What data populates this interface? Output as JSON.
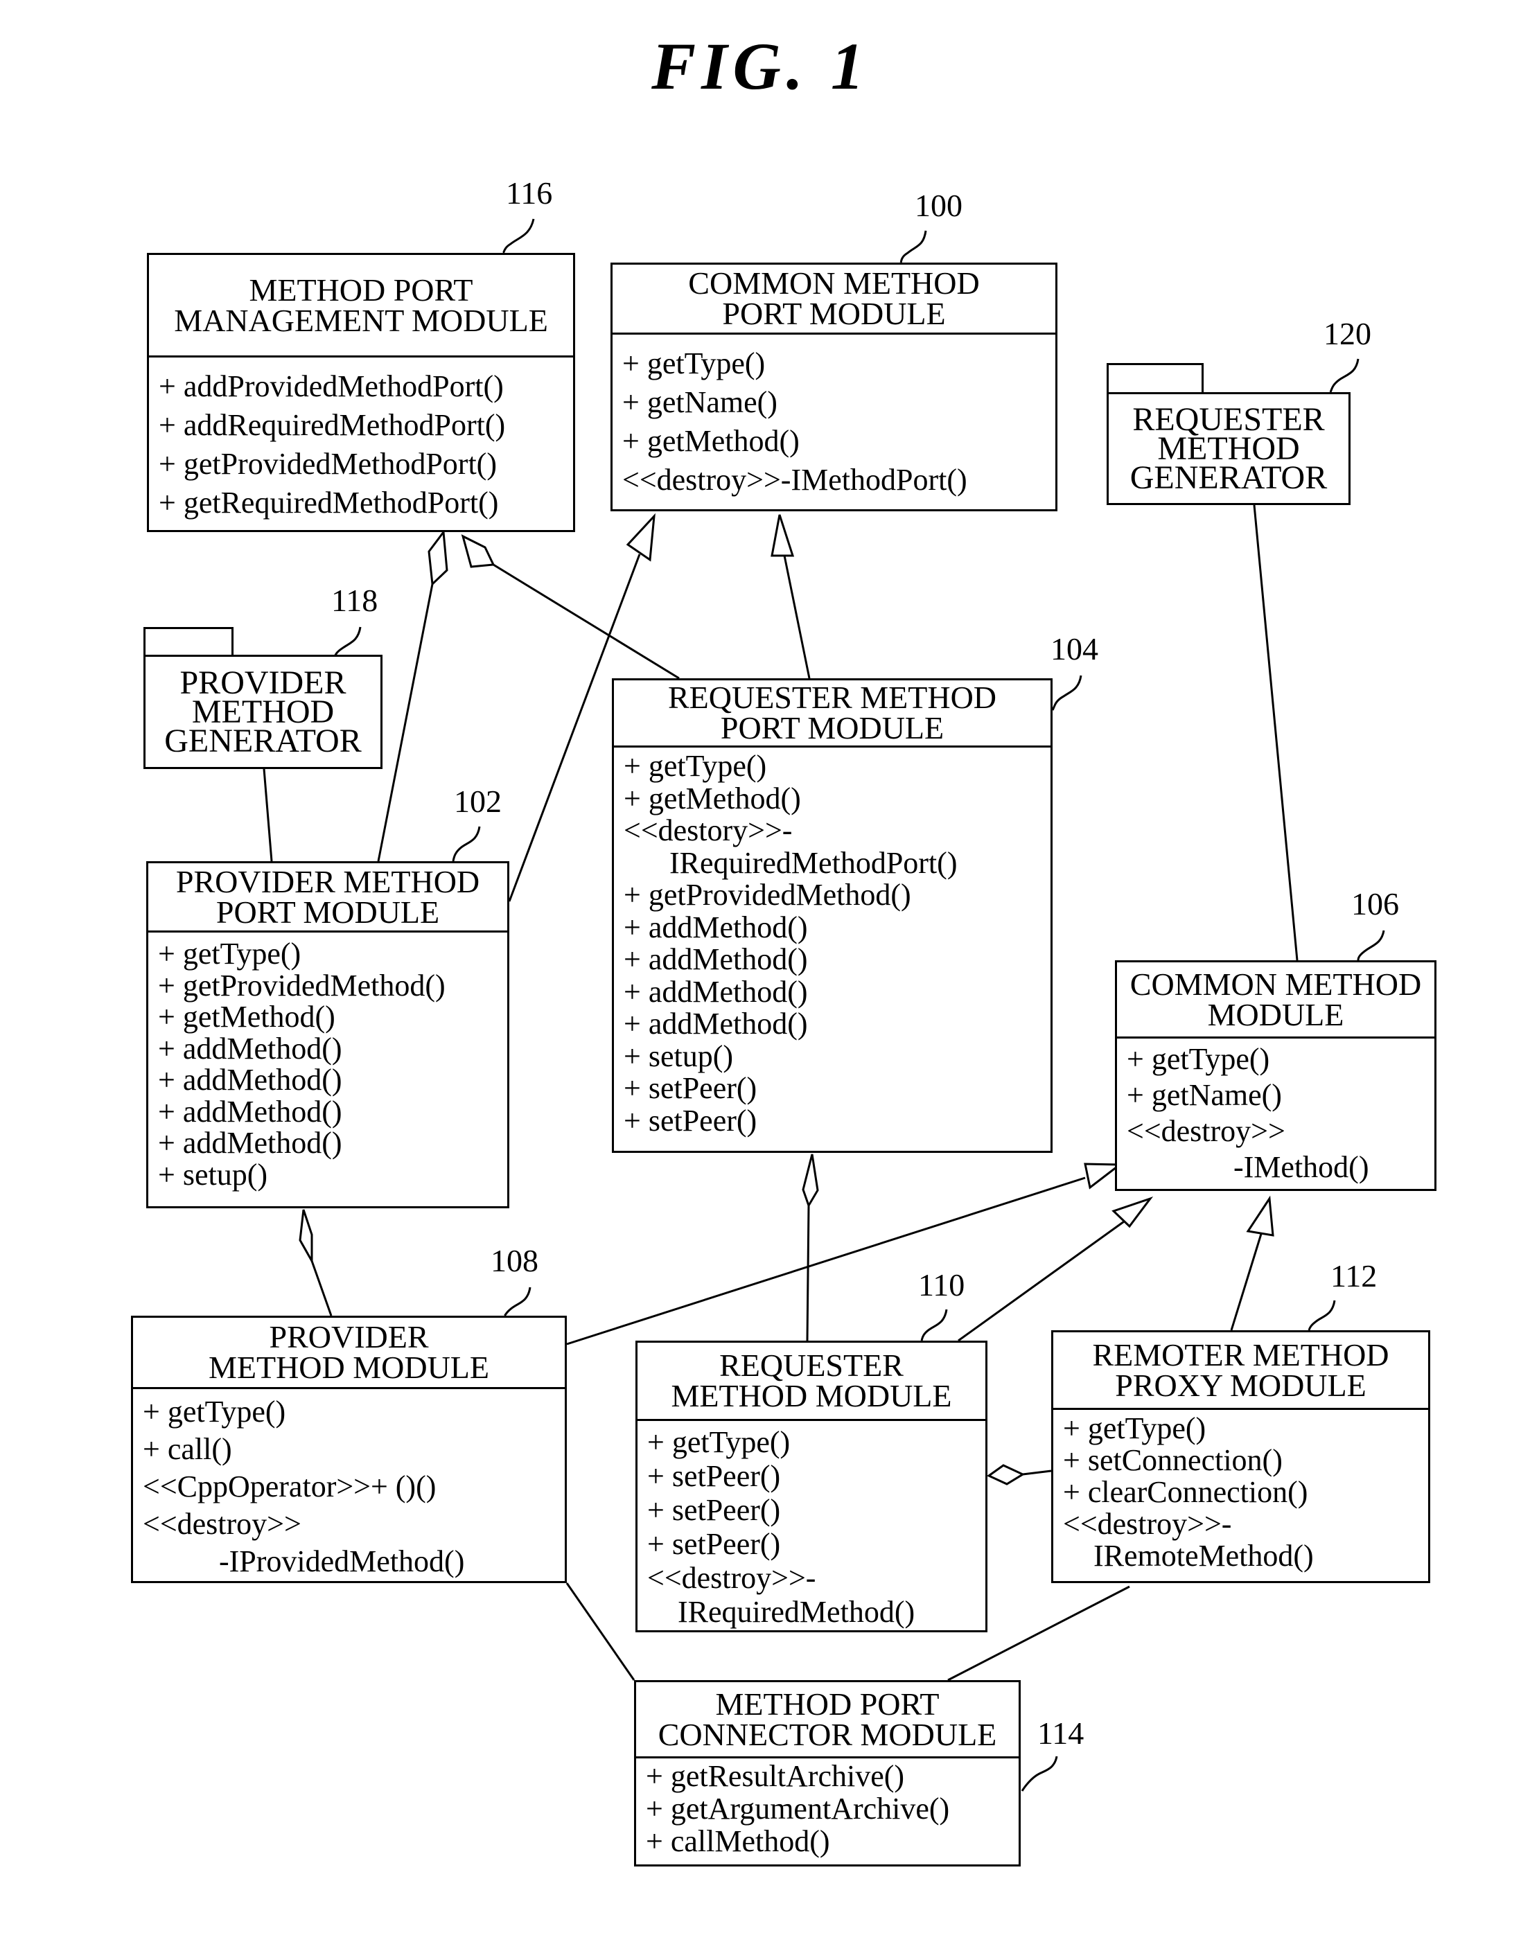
{
  "figure": {
    "title": "FIG. 1"
  },
  "modules": {
    "m116": {
      "ref": "116",
      "title": [
        "METHOD PORT",
        "MANAGEMENT MODULE"
      ],
      "ops": [
        "+ addProvidedMethodPort()",
        "+ addRequiredMethodPort()",
        "+ getProvidedMethodPort()",
        "+ getRequiredMethodPort()"
      ]
    },
    "m100": {
      "ref": "100",
      "title": [
        "COMMON METHOD",
        "PORT MODULE"
      ],
      "ops": [
        "+ getType()",
        "+ getName()",
        "+ getMethod()",
        "<<destroy>>-IMethodPort()"
      ]
    },
    "m120": {
      "ref": "120",
      "title": [
        "REQUESTER",
        "METHOD",
        "GENERATOR"
      ]
    },
    "m118": {
      "ref": "118",
      "title": [
        "PROVIDER",
        "METHOD",
        "GENERATOR"
      ]
    },
    "m104": {
      "ref": "104",
      "title": [
        "REQUESTER METHOD",
        "PORT MODULE"
      ],
      "ops": [
        "+ getType()",
        "+ getMethod()",
        "<<destory>>-",
        "      IRequiredMethodPort()",
        "+ getProvidedMethod()",
        "+ addMethod()",
        "+ addMethod()",
        "+ addMethod()",
        "+ addMethod()",
        "+ setup()",
        "+ setPeer()",
        "+ setPeer()"
      ]
    },
    "m102": {
      "ref": "102",
      "title": [
        "PROVIDER METHOD",
        "PORT MODULE"
      ],
      "ops": [
        "+ getType()",
        "+ getProvidedMethod()",
        "+ getMethod()",
        "+ addMethod()",
        "+ addMethod()",
        "+ addMethod()",
        "+ addMethod()",
        "+ setup()"
      ]
    },
    "m106": {
      "ref": "106",
      "title": [
        "COMMON METHOD",
        "MODULE"
      ],
      "ops": [
        "+ getType()",
        "+ getName()",
        "<<destroy>>",
        "              -IMethod()"
      ]
    },
    "m108": {
      "ref": "108",
      "title": [
        "PROVIDER",
        "METHOD MODULE"
      ],
      "ops": [
        "+ getType()",
        "+ call()",
        "<<CppOperator>>+ ()()",
        "<<destroy>>",
        "          -IProvidedMethod()"
      ]
    },
    "m110": {
      "ref": "110",
      "title": [
        "REQUESTER",
        "METHOD MODULE"
      ],
      "ops": [
        "+ getType()",
        "+ setPeer()",
        "+ setPeer()",
        "+ setPeer()",
        "<<destroy>>-",
        "    IRequiredMethod()"
      ]
    },
    "m112": {
      "ref": "112",
      "title": [
        "REMOTER METHOD",
        "PROXY MODULE"
      ],
      "ops": [
        "+ getType()",
        "+ setConnection()",
        "+ clearConnection()",
        "<<destroy>>-",
        "    IRemoteMethod()"
      ]
    },
    "m114": {
      "ref": "114",
      "title": [
        "METHOD PORT",
        "CONNECTOR MODULE"
      ],
      "ops": [
        "+ getResultArchive()",
        "+ getArgumentArchive()",
        "+ callMethod()"
      ]
    }
  },
  "relations": [
    {
      "from": "m102",
      "to": "m116",
      "type": "aggregation"
    },
    {
      "from": "m104",
      "to": "m116",
      "type": "aggregation"
    },
    {
      "from": "m102",
      "to": "m100",
      "type": "generalization"
    },
    {
      "from": "m104",
      "to": "m100",
      "type": "generalization"
    },
    {
      "from": "m118",
      "to": "m102",
      "type": "association"
    },
    {
      "from": "m120",
      "to": "m106",
      "type": "association"
    },
    {
      "from": "m108",
      "to": "m102",
      "type": "aggregation"
    },
    {
      "from": "m110",
      "to": "m104",
      "type": "aggregation"
    },
    {
      "from": "m108",
      "to": "m106",
      "type": "generalization"
    },
    {
      "from": "m110",
      "to": "m106",
      "type": "generalization"
    },
    {
      "from": "m112",
      "to": "m106",
      "type": "generalization"
    },
    {
      "from": "m112",
      "to": "m110",
      "type": "aggregation"
    },
    {
      "from": "m108",
      "to": "m114",
      "type": "association"
    },
    {
      "from": "m112",
      "to": "m114",
      "type": "association"
    }
  ]
}
